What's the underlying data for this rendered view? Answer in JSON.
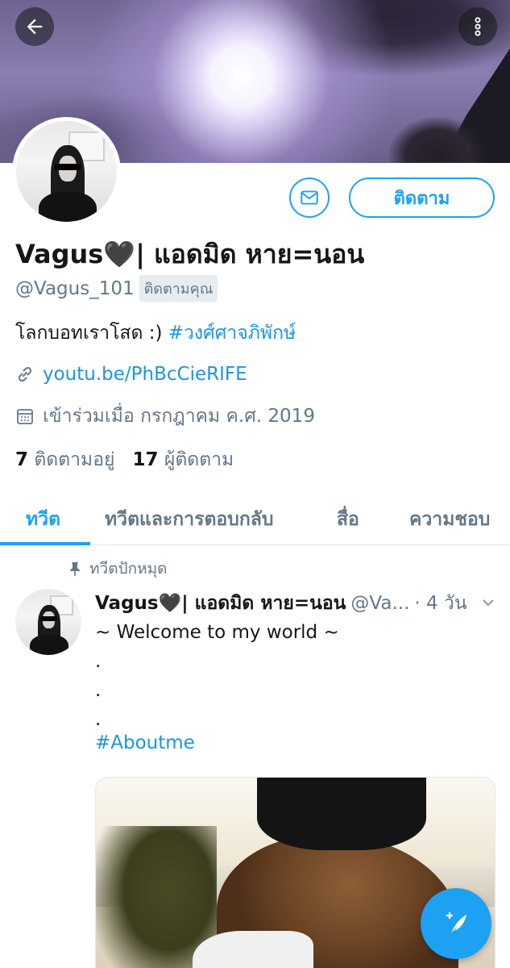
{
  "header": {
    "back_icon": "arrow-left-icon",
    "more_icon": "more-vertical-icon"
  },
  "profile": {
    "display_name": "Vagus🖤| แอดมิด หาย=นอน",
    "handle": "@Vagus_101",
    "follows_you_badge": "ติดตามคุณ",
    "bio_text": "โลกบอทเราโสด :) ",
    "bio_hashtag": "#วงศ์ศาจภิพักษ์",
    "link": "youtu.be/PhBcCieRIFE",
    "joined": "เข้าร่วมเมื่อ กรกฎาคม ค.ศ. 2019",
    "following_count": "7",
    "following_label": "ติดตามอยู่",
    "followers_count": "17",
    "followers_label": "ผู้ติดตาม"
  },
  "actions": {
    "message_icon": "mail-icon",
    "follow_label": "ติดตาม"
  },
  "tabs": [
    {
      "label": "ทวีต",
      "active": true
    },
    {
      "label": "ทวีตและการตอบกลับ",
      "active": false
    },
    {
      "label": "สื่อ",
      "active": false
    },
    {
      "label": "ความชอบ",
      "active": false
    }
  ],
  "tweet": {
    "pinned_label": "ทวีตปักหมุด",
    "author_name": "Vagus🖤| แอดมิด หาย=นอน",
    "author_handle": "@Va...",
    "time": "· 4 วัน",
    "text": "~ Welcome to my world ~\n.\n.\n.",
    "hashtag": "#Aboutme"
  },
  "colors": {
    "accent": "#1da1f2",
    "link": "#1b95e0",
    "secondary_text": "#657786"
  },
  "fab": {
    "icon": "compose-tweet-icon"
  }
}
